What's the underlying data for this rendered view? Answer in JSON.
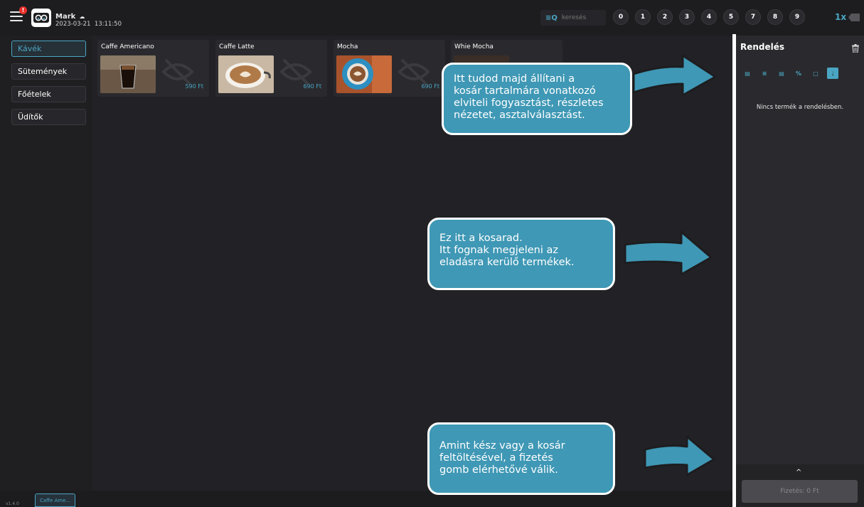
{
  "header": {
    "user_name": "Mark",
    "date": "2023-03-21",
    "time": "13:11:50",
    "notification_count": "!",
    "search_placeholder": "keresés",
    "quantity_keys": [
      "0",
      "1",
      "2",
      "3",
      "4",
      "5",
      "7",
      "8",
      "9"
    ],
    "multiplier": "1x"
  },
  "categories": [
    {
      "label": "Kávék",
      "active": true
    },
    {
      "label": "Sütemények",
      "active": false
    },
    {
      "label": "Főételek",
      "active": false
    },
    {
      "label": "Üdítők",
      "active": false
    }
  ],
  "products": [
    {
      "name": "Caffe Americano",
      "price": "590 Ft"
    },
    {
      "name": "Caffe Latte",
      "price": "690 Ft"
    },
    {
      "name": "Mocha",
      "price": "690 Ft"
    },
    {
      "name": "Whie Mocha",
      "price": ""
    }
  ],
  "order": {
    "title": "Rendelés",
    "empty_text": "Nincs termék a rendelésben.",
    "pay_label": "Fizetés: 0 Ft",
    "expand_icon": "^"
  },
  "bottom": {
    "version": "v1.4.0",
    "tab_label": "Caffe Ame..."
  },
  "tooltips": [
    {
      "text": "Itt tudod majd állítani a\nkosár tartalmára vonatkozó\nelviteli fogyasztást, részletes\nnézetet, asztalválasztást."
    },
    {
      "text": "Ez itt a kosarad.\nItt fognak megjeleni az\neladásra kerülő termékek."
    },
    {
      "text": "Amint kész vagy a kosár\nfeltöltésével, a fizetés\ngomb elérhetővé válik."
    }
  ],
  "colors": {
    "accent": "#4aa6c3",
    "background": "#222226",
    "tooltip": "#3f98b5"
  }
}
